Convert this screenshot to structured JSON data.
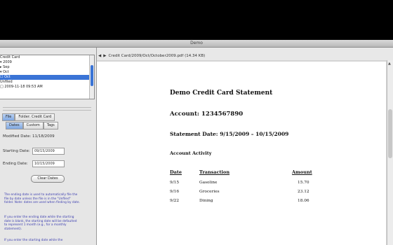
{
  "window": {
    "title": "Demo"
  },
  "tree": {
    "rows": [
      "Credit Card",
      "▾ 2009",
      "  ▸ Sep",
      "  ▾ Oct",
      "    ☐ Oct",
      "Unfiled",
      "  □ 2009-11-18 09:53 AM"
    ],
    "selected_index": 4
  },
  "tabs_primary": [
    "File",
    "Folder: Credit Card"
  ],
  "tabs_secondary": [
    "Dates",
    "Custom",
    "Tags"
  ],
  "dates_panel": {
    "modified_label": "Modified Date:",
    "modified_value": "11/18/2009",
    "starting_label": "Starting Date:",
    "starting_value": "09/15/2009",
    "ending_label": "Ending Date:",
    "ending_value": "10/15/2009",
    "clear_button": "Clear Dates"
  },
  "help_text": [
    "The ending date is used to automatically file the file by date unless the file is in the \"Unfiled\" folder. Note: dates are used when finding by date.",
    "If you enter the ending date while the starting date is blank, the starting date will be defaulted to represent 1 month (e.g., for a monthly statement).",
    "If you enter the starting date while the"
  ],
  "path": "Credit Card/2009/Oct/October2009.pdf (14.34 KB)",
  "document": {
    "title": "Demo Credit Card Statement",
    "account": "Account: 1234567890",
    "statement_date": "Statement Date: 9/15/2009 – 10/15/2009",
    "activity_heading": "Account Activity",
    "columns": [
      "Date",
      "Transaction",
      "Amount"
    ],
    "rows": [
      {
        "date": "9/15",
        "transaction": "Gasoline",
        "amount": "15.70"
      },
      {
        "date": "9/16",
        "transaction": "Groceries",
        "amount": "23.12"
      },
      {
        "date": "9/22",
        "transaction": "Dining",
        "amount": "18.06"
      }
    ]
  }
}
